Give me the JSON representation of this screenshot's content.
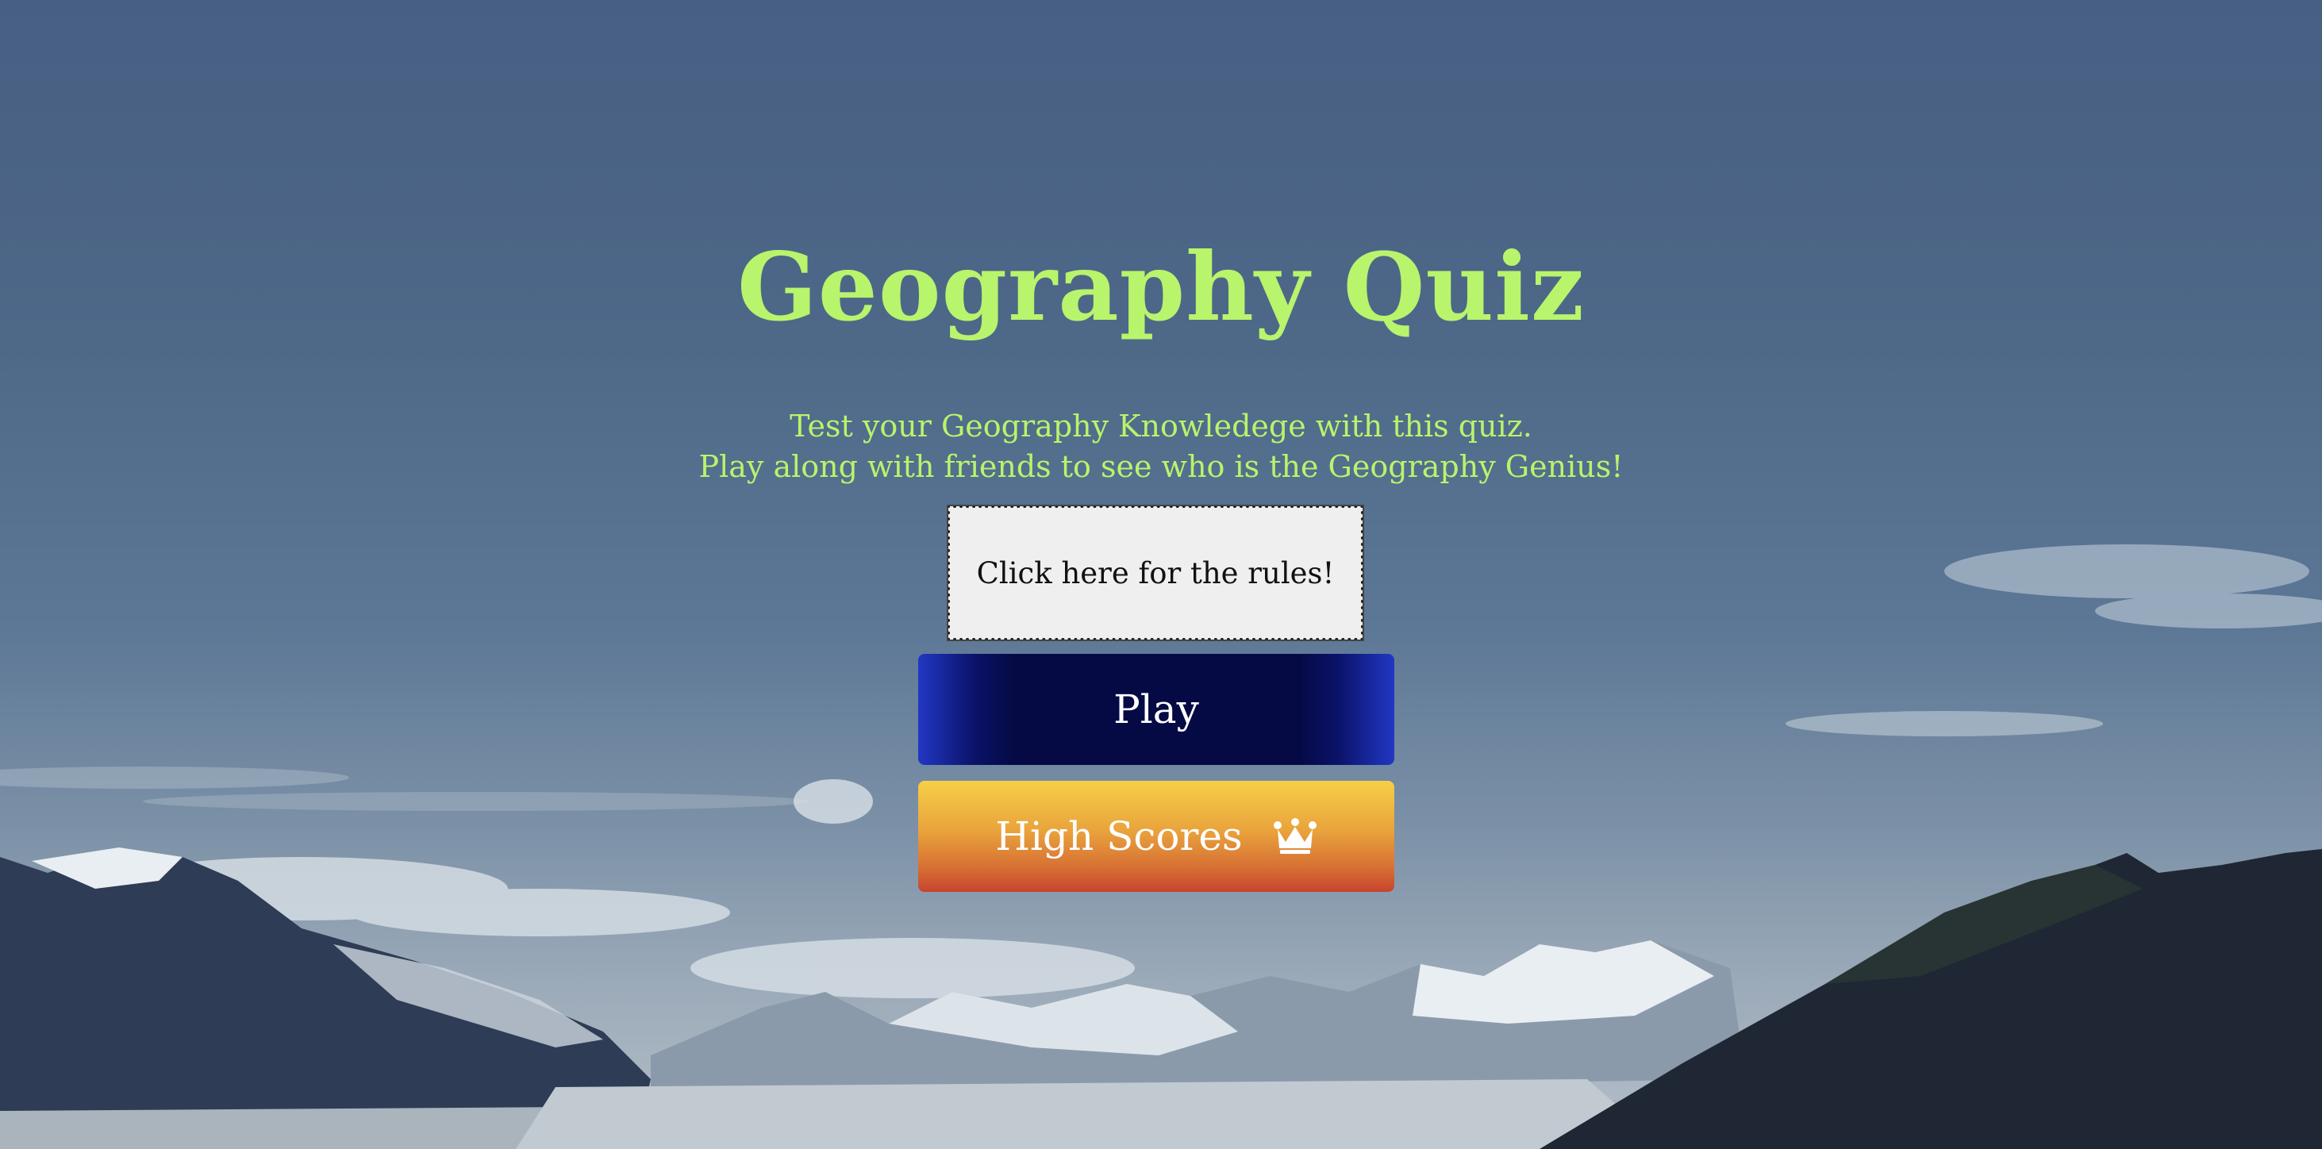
{
  "page": {
    "title": "Geography Quiz",
    "subtitle_line1": "Test your Geography Knowledege with this quiz.",
    "subtitle_line2": "Play along with friends to see who is the Geography Genius!"
  },
  "buttons": {
    "rules_label": "Click here for the rules!",
    "play_label": "Play",
    "high_scores_label": "High Scores",
    "high_scores_icon": "crown-icon"
  },
  "colors": {
    "title": "#b8f46c",
    "play_button": "#050a45",
    "high_scores_top": "#f6cf47",
    "high_scores_bottom": "#c7432d",
    "rules_button": "#efefef"
  }
}
